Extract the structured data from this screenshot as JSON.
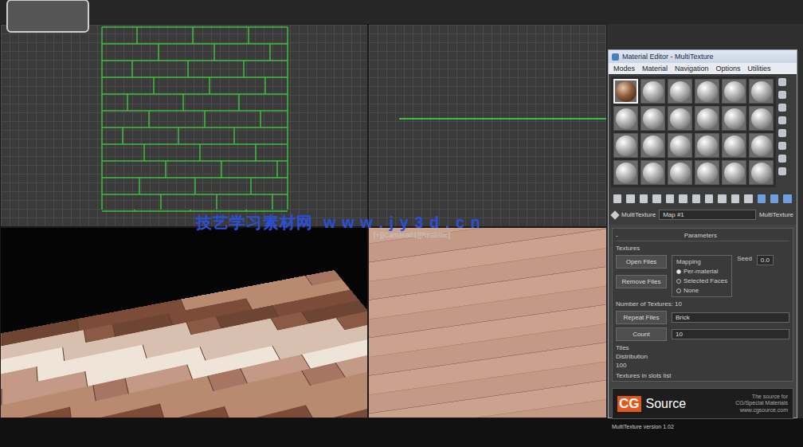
{
  "watermark": "技艺学习素材网  w w w . j y 3 d . c n",
  "camera_viewport": {
    "label": "[+][Camera01][Realistic]"
  },
  "material_editor": {
    "title": "Material Editor - MultiTexture",
    "menu": [
      "Modes",
      "Material",
      "Navigation",
      "Options",
      "Utilities"
    ],
    "slots": [
      {
        "selected": true,
        "kind": "wood"
      },
      {
        "selected": false,
        "kind": "blank"
      },
      {
        "selected": false,
        "kind": "blank"
      },
      {
        "selected": false,
        "kind": "blank"
      },
      {
        "selected": false,
        "kind": "blank"
      },
      {
        "selected": false,
        "kind": "blank"
      },
      {
        "selected": false,
        "kind": "blank"
      },
      {
        "selected": false,
        "kind": "blank"
      },
      {
        "selected": false,
        "kind": "blank"
      },
      {
        "selected": false,
        "kind": "blank"
      },
      {
        "selected": false,
        "kind": "blank"
      },
      {
        "selected": false,
        "kind": "blank"
      },
      {
        "selected": false,
        "kind": "blank"
      },
      {
        "selected": false,
        "kind": "blank"
      },
      {
        "selected": false,
        "kind": "blank"
      },
      {
        "selected": false,
        "kind": "blank"
      },
      {
        "selected": false,
        "kind": "blank"
      },
      {
        "selected": false,
        "kind": "blank"
      },
      {
        "selected": false,
        "kind": "blank"
      },
      {
        "selected": false,
        "kind": "blank"
      },
      {
        "selected": false,
        "kind": "blank"
      },
      {
        "selected": false,
        "kind": "blank"
      },
      {
        "selected": false,
        "kind": "blank"
      },
      {
        "selected": false,
        "kind": "blank"
      }
    ],
    "name_label": "MultiTexture",
    "name_field": "Map #1",
    "type_button": "MultiTexture",
    "rollout": {
      "title": "Parameters",
      "toggle": "-"
    },
    "textures_label": "Textures",
    "buttons": [
      "Open Files",
      "Remove Files"
    ],
    "mapping": {
      "label": "Mapping",
      "options": [
        {
          "label": "Per-material",
          "selected": true
        },
        {
          "label": "Selected Faces",
          "selected": false
        },
        {
          "label": "None",
          "selected": false
        }
      ]
    },
    "seed": {
      "label": "Seed",
      "value": "0.0"
    },
    "count_label": "Number of Textures: 10",
    "lower_rows": [
      {
        "label": "Repeat Files",
        "value": "Brick"
      },
      {
        "label": "Count",
        "value": "10"
      }
    ],
    "notes": [
      "Tiles",
      "Distribution",
      "100"
    ],
    "texture_list": "Textures in slots list",
    "banner": {
      "cg": "CG",
      "source": "Source",
      "text": "The source for CG/Special Materials www.cgsource.com"
    },
    "footer": "MultiTexture version 1.02"
  }
}
